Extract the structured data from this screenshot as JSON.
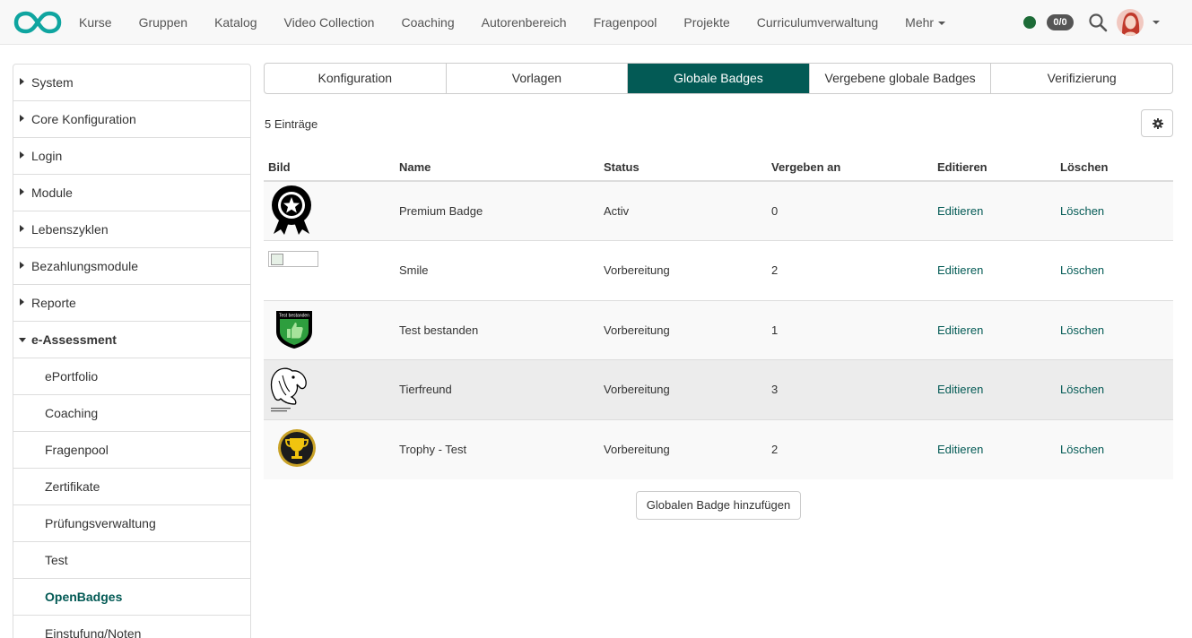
{
  "nav": {
    "items": [
      "Kurse",
      "Gruppen",
      "Katalog",
      "Video Collection",
      "Coaching",
      "Autorenbereich",
      "Fragenpool",
      "Projekte",
      "Curriculumverwaltung"
    ],
    "more_label": "Mehr",
    "counter": "0/0"
  },
  "sidebar": {
    "items": [
      {
        "label": "System"
      },
      {
        "label": "Core Konfiguration"
      },
      {
        "label": "Login"
      },
      {
        "label": "Module"
      },
      {
        "label": "Lebenszyklen"
      },
      {
        "label": "Bezahlungsmodule"
      },
      {
        "label": "Reporte"
      },
      {
        "label": "e-Assessment"
      }
    ],
    "subitems": [
      {
        "label": "ePortfolio"
      },
      {
        "label": "Coaching"
      },
      {
        "label": "Fragenpool"
      },
      {
        "label": "Zertifikate"
      },
      {
        "label": "Prüfungsverwaltung"
      },
      {
        "label": "Test"
      },
      {
        "label": "OpenBadges"
      },
      {
        "label": "Einstufung/Noten"
      }
    ]
  },
  "tabs": [
    "Konfiguration",
    "Vorlagen",
    "Globale Badges",
    "Vergebene globale Badges",
    "Verifizierung"
  ],
  "entries_label": "5 Einträge",
  "table": {
    "headers": [
      "Bild",
      "Name",
      "Status",
      "Vergeben an",
      "Editieren",
      "Löschen"
    ],
    "rows": [
      {
        "name": "Premium Badge",
        "status": "Activ",
        "awarded": "0",
        "edit": "Editieren",
        "delete": "Löschen"
      },
      {
        "name": "Smile",
        "status": "Vorbereitung",
        "awarded": "2",
        "edit": "Editieren",
        "delete": "Löschen"
      },
      {
        "name": "Test bestanden",
        "status": "Vorbereitung",
        "awarded": "1",
        "edit": "Editieren",
        "delete": "Löschen"
      },
      {
        "name": "Tierfreund",
        "status": "Vorbereitung",
        "awarded": "3",
        "edit": "Editieren",
        "delete": "Löschen"
      },
      {
        "name": "Trophy - Test",
        "status": "Vorbereitung",
        "awarded": "2",
        "edit": "Editieren",
        "delete": "Löschen"
      }
    ]
  },
  "badge_text": "Test bestanden",
  "add_button": "Globalen Badge hinzufügen",
  "colors": {
    "accent": "#035a55",
    "status_online": "#1d6b37"
  }
}
